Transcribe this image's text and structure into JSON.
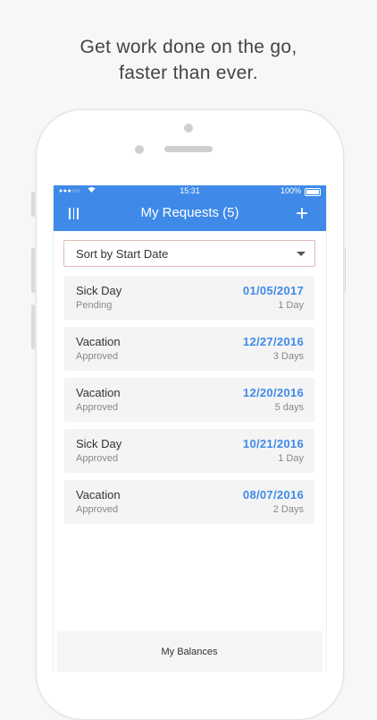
{
  "headline": {
    "line1": "Get work done on the go,",
    "line2": "faster than ever."
  },
  "status_bar": {
    "signal": "●●●○○",
    "wifi": "wifi-icon",
    "time": "15:31",
    "battery_pct": "100%"
  },
  "app_bar": {
    "title": "My Requests (5)",
    "menu_icon": "menu-icon",
    "add_icon": "plus-icon",
    "color": "#3f8ae8"
  },
  "sort": {
    "label": "Sort by Start Date"
  },
  "requests": [
    {
      "type": "Sick Day",
      "status": "Pending",
      "date": "01/05/2017",
      "duration": "1 Day"
    },
    {
      "type": "Vacation",
      "status": "Approved",
      "date": "12/27/2016",
      "duration": "3 Days"
    },
    {
      "type": "Vacation",
      "status": "Approved",
      "date": "12/20/2016",
      "duration": "5 days"
    },
    {
      "type": "Sick Day",
      "status": "Approved",
      "date": "10/21/2016",
      "duration": "1 Day"
    },
    {
      "type": "Vacation",
      "status": "Approved",
      "date": "08/07/2016",
      "duration": "2 Days"
    }
  ],
  "bottom": {
    "label": "My Balances"
  }
}
